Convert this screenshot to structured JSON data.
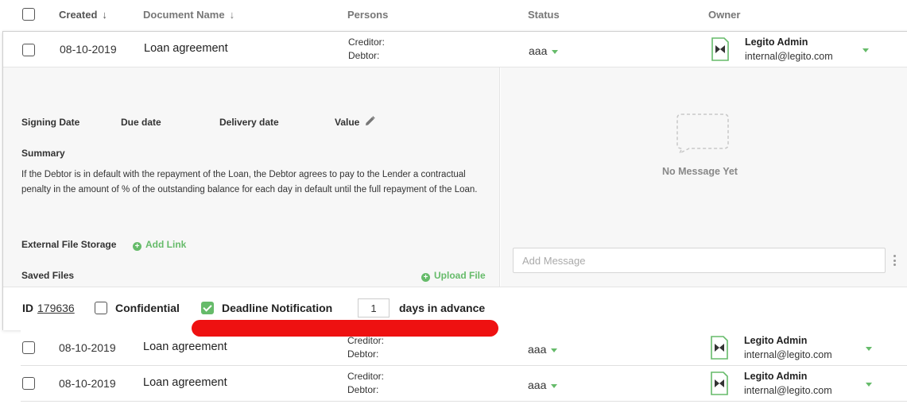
{
  "header": {
    "created": "Created",
    "document_name": "Document Name",
    "persons": "Persons",
    "status": "Status",
    "owner": "Owner"
  },
  "expanded": {
    "date": "08-10-2019",
    "name": "Loan agreement",
    "creditor_label": "Creditor:",
    "debtor_label": "Debtor:",
    "status": "aaa",
    "owner_name": "Legito Admin",
    "owner_email": "internal@legito.com",
    "fields": {
      "signing_date": "Signing Date",
      "due_date": "Due date",
      "delivery_date": "Delivery date",
      "value": "Value"
    },
    "summary_label": "Summary",
    "summary_text": "If the Debtor is in default with the repayment of the Loan, the Debtor agrees to pay to the Lender a contractual penalty in the amount of % of the outstanding balance for each day in default until the full repayment of the Loan.",
    "external_storage_label": "External File Storage",
    "add_link": "Add Link",
    "saved_files_label": "Saved Files",
    "upload_file": "Upload File",
    "chat": {
      "empty": "No Message Yet",
      "placeholder": "Add Message"
    },
    "footer": {
      "id_label": "ID",
      "id_value": "179636",
      "confidential": "Confidential",
      "confidential_checked": false,
      "deadline": "Deadline Notification",
      "deadline_checked": true,
      "days_value": "1",
      "days_suffix": "days in advance"
    }
  },
  "rows": [
    {
      "date": "08-10-2019",
      "name": "Loan agreement",
      "creditor_label": "Creditor:",
      "debtor_label": "Debtor:",
      "status": "aaa",
      "owner_name": "Legito Admin",
      "owner_email": "internal@legito.com"
    },
    {
      "date": "08-10-2019",
      "name": "Loan agreement",
      "creditor_label": "Creditor:",
      "debtor_label": "Debtor:",
      "status": "aaa",
      "owner_name": "Legito Admin",
      "owner_email": "internal@legito.com"
    }
  ],
  "colors": {
    "accent": "#66bb6a",
    "annotation": "#ee1111"
  }
}
